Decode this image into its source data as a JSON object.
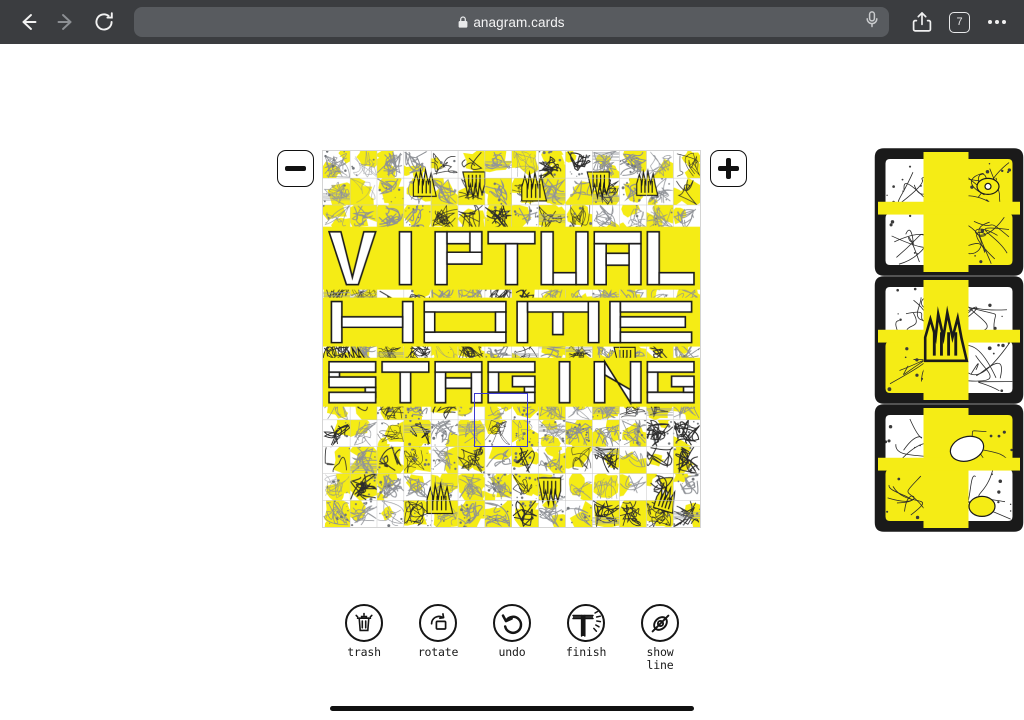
{
  "browser": {
    "url": "anagram.cards",
    "secure_icon": "lock-icon",
    "back_icon": "back-arrow-icon",
    "forward_icon": "forward-arrow-icon",
    "reload_icon": "reload-icon",
    "mic_icon": "microphone-icon",
    "share_icon": "share-icon",
    "tab_count": "7",
    "more_icon": "more-ellipsis-icon",
    "chrome_bg": "#3b3d40",
    "url_field_bg": "#585b5f"
  },
  "canvas": {
    "zoom_out_label": "−",
    "zoom_in_label": "+",
    "artwork_text_lines": [
      "VIRTUAL",
      "HOME",
      "STAGING"
    ],
    "grid_cols": 14,
    "grid_rows": 14,
    "selected_cell": {
      "col": 5,
      "row": 8,
      "span": 2
    },
    "selection_color": "#3a3ad0",
    "accent_color": "#f5ec15",
    "ink_color": "#1a1a1a",
    "grid_line_color": "#c8c8c8"
  },
  "tray": {
    "card_count": 3,
    "cards": [
      {
        "name": "card-feather-eye"
      },
      {
        "name": "card-hands"
      },
      {
        "name": "card-fish-cat"
      }
    ]
  },
  "toolbar": {
    "items": [
      {
        "label": "trash",
        "icon": "trash-icon",
        "name": "trash-button"
      },
      {
        "label": "rotate",
        "icon": "rotate-icon",
        "name": "rotate-button"
      },
      {
        "label": "undo",
        "icon": "undo-icon",
        "name": "undo-button"
      },
      {
        "label": "finish",
        "icon": "finish-icon",
        "name": "finish-button"
      },
      {
        "label": "show\nline",
        "icon": "hide-line-icon",
        "name": "show-line-button"
      }
    ]
  }
}
